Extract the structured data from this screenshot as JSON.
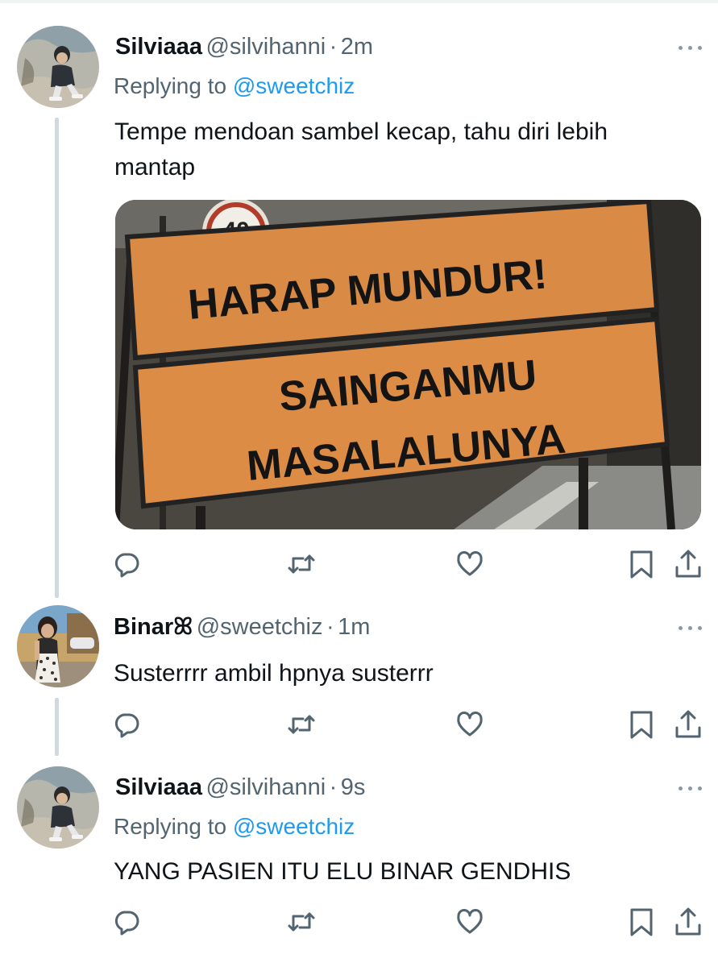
{
  "tweets": [
    {
      "name": "Silviaaa",
      "handle": "@silvihanni",
      "separator": "·",
      "time": "2m",
      "replying_prefix": "Replying to",
      "replying_to": "@sweetchiz",
      "text": "Tempe mendoan sambel kecap, tahu diri lebih mantap",
      "media": {
        "sign_top": "HARAP MUNDUR!",
        "sign_line1": "SAINGANMU",
        "sign_line2": "MASALALUNYA",
        "speed_sign": "40"
      }
    },
    {
      "name": "Binar",
      "emoji": "ꕤ",
      "handle": "@sweetchiz",
      "separator": "·",
      "time": "1m",
      "text": "Susterrrr ambil hpnya susterrr"
    },
    {
      "name": "Silviaaa",
      "handle": "@silvihanni",
      "separator": "·",
      "time": "9s",
      "replying_prefix": "Replying to",
      "replying_to": "@sweetchiz",
      "text": "YANG PASIEN ITU ELU BINAR GENDHIS"
    }
  ],
  "icons": [
    "reply-icon",
    "retweet-icon",
    "like-icon",
    "bookmark-icon",
    "share-icon",
    "more-icon"
  ],
  "colors": {
    "accent": "#1d9bf0",
    "secondary_text": "#536471",
    "thread_line": "#cfd9de",
    "sign_orange": "#e08a3c"
  }
}
